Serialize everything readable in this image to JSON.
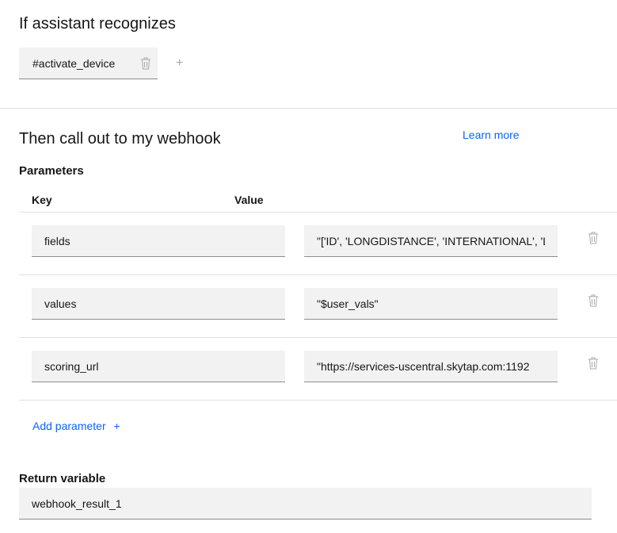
{
  "condition": {
    "heading": "If assistant recognizes",
    "intent_tag": "#activate_device"
  },
  "webhook": {
    "heading": "Then call out to my webhook",
    "learn_more": "Learn more"
  },
  "parameters": {
    "heading": "Parameters",
    "key_header": "Key",
    "value_header": "Value",
    "rows": [
      {
        "key": "fields",
        "value": "\"['ID', 'LONGDISTANCE', 'INTERNATIONAL', 'L"
      },
      {
        "key": "values",
        "value": "\"$user_vals\""
      },
      {
        "key": "scoring_url",
        "value": "\"https://services-uscentral.skytap.com:1192"
      }
    ],
    "add_label": "Add parameter",
    "add_icon": "+"
  },
  "return_variable": {
    "heading": "Return variable",
    "value": "webhook_result_1"
  },
  "icons": {
    "trash": "trash-can-icon",
    "add": "plus-icon"
  },
  "colors": {
    "link": "#0f62fe",
    "field_bg": "#f2f2f2",
    "divider": "#e0e0e0"
  }
}
